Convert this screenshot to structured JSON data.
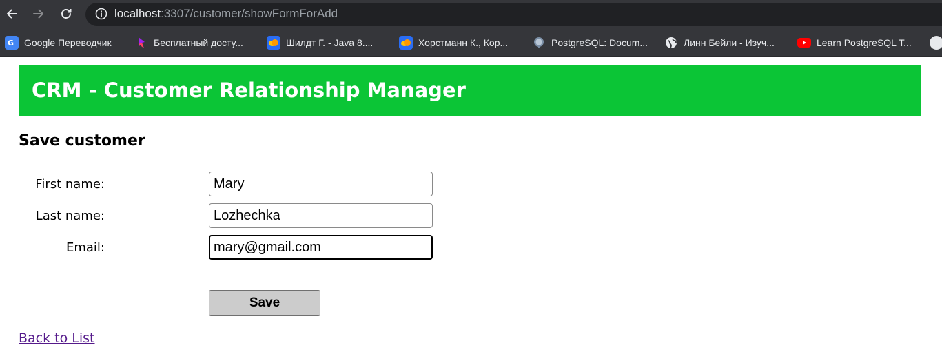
{
  "browser": {
    "url_host": "localhost",
    "url_path": ":3307/customer/showFormForAdd",
    "bookmarks": [
      {
        "label": "Google Переводчик",
        "icon": "google-translate-icon"
      },
      {
        "label": "Бесплатный досту...",
        "icon": "bookmark-icon"
      },
      {
        "label": "Шилдт Г. - Java 8....",
        "icon": "cloud-icon"
      },
      {
        "label": "Хорстманн К., Кор...",
        "icon": "cloud-icon"
      },
      {
        "label": "PostgreSQL: Docum...",
        "icon": "postgresql-icon"
      },
      {
        "label": "Линн Бейли - Изуч...",
        "icon": "globe-icon"
      },
      {
        "label": "Learn PostgreSQL T...",
        "icon": "youtube-icon"
      }
    ]
  },
  "header": {
    "title": "CRM - Customer Relationship Manager",
    "bg_color": "#0bc536"
  },
  "form": {
    "heading": "Save customer",
    "first_name": {
      "label": "First name:",
      "value": "Mary"
    },
    "last_name": {
      "label": "Last name:",
      "value": "Lozhechka"
    },
    "email": {
      "label": "Email:",
      "value": "mary@gmail.com"
    },
    "save_label": "Save"
  },
  "back_link": "Back to List"
}
